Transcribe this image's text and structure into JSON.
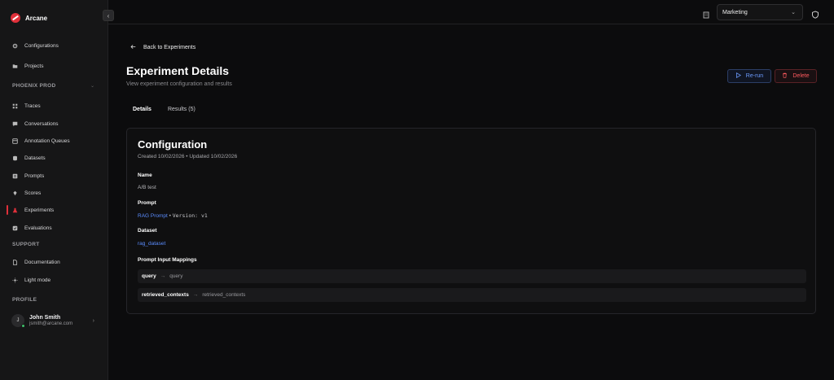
{
  "brand": {
    "name": "Arcane"
  },
  "sidebar": {
    "top_items": [
      {
        "label": "Configurations",
        "icon": "gear-icon"
      },
      {
        "label": "Projects",
        "icon": "folder-icon"
      }
    ],
    "project_section": "PHOENIX PROD",
    "project_items": [
      {
        "label": "Traces",
        "icon": "grid-icon"
      },
      {
        "label": "Conversations",
        "icon": "chat-icon"
      },
      {
        "label": "Annotation Queues",
        "icon": "queue-icon"
      },
      {
        "label": "Datasets",
        "icon": "database-icon"
      },
      {
        "label": "Prompts",
        "icon": "prompt-icon"
      },
      {
        "label": "Scores",
        "icon": "scores-icon"
      },
      {
        "label": "Experiments",
        "icon": "flask-icon"
      },
      {
        "label": "Evaluations",
        "icon": "evaluations-icon"
      }
    ],
    "support_section": "SUPPORT",
    "support_items": [
      {
        "label": "Documentation",
        "icon": "document-icon"
      },
      {
        "label": "Light mode",
        "icon": "sun-icon"
      }
    ],
    "profile_section": "PROFILE",
    "profile": {
      "initial": "J",
      "name": "John Smith",
      "email": "jsmith@arcane.com"
    }
  },
  "topbar": {
    "workspace": "Marketing"
  },
  "main": {
    "back_label": "Back to Experiments",
    "title": "Experiment Details",
    "subtitle": "View experiment configuration and results",
    "rerun_label": "Re-run",
    "delete_label": "Delete",
    "tabs": [
      {
        "label": "Details"
      },
      {
        "label": "Results (5)"
      }
    ]
  },
  "config": {
    "title": "Configuration",
    "meta": "Created 10/02/2026 • Updated 10/02/2026",
    "name_label": "Name",
    "name_value": "A/B test",
    "prompt_label": "Prompt",
    "prompt_name": "RAG Prompt",
    "prompt_sep": "•",
    "prompt_version": "Version: v1",
    "dataset_label": "Dataset",
    "dataset_value": "rag_dataset",
    "mappings_label": "Prompt Input Mappings",
    "mappings": [
      {
        "key": "query",
        "value": "query"
      },
      {
        "key": "retrieved_contexts",
        "value": "retrieved_contexts"
      }
    ]
  },
  "colors": {
    "accent": "#e0303a",
    "link": "#5b8dff",
    "danger": "#ff5a5f"
  }
}
